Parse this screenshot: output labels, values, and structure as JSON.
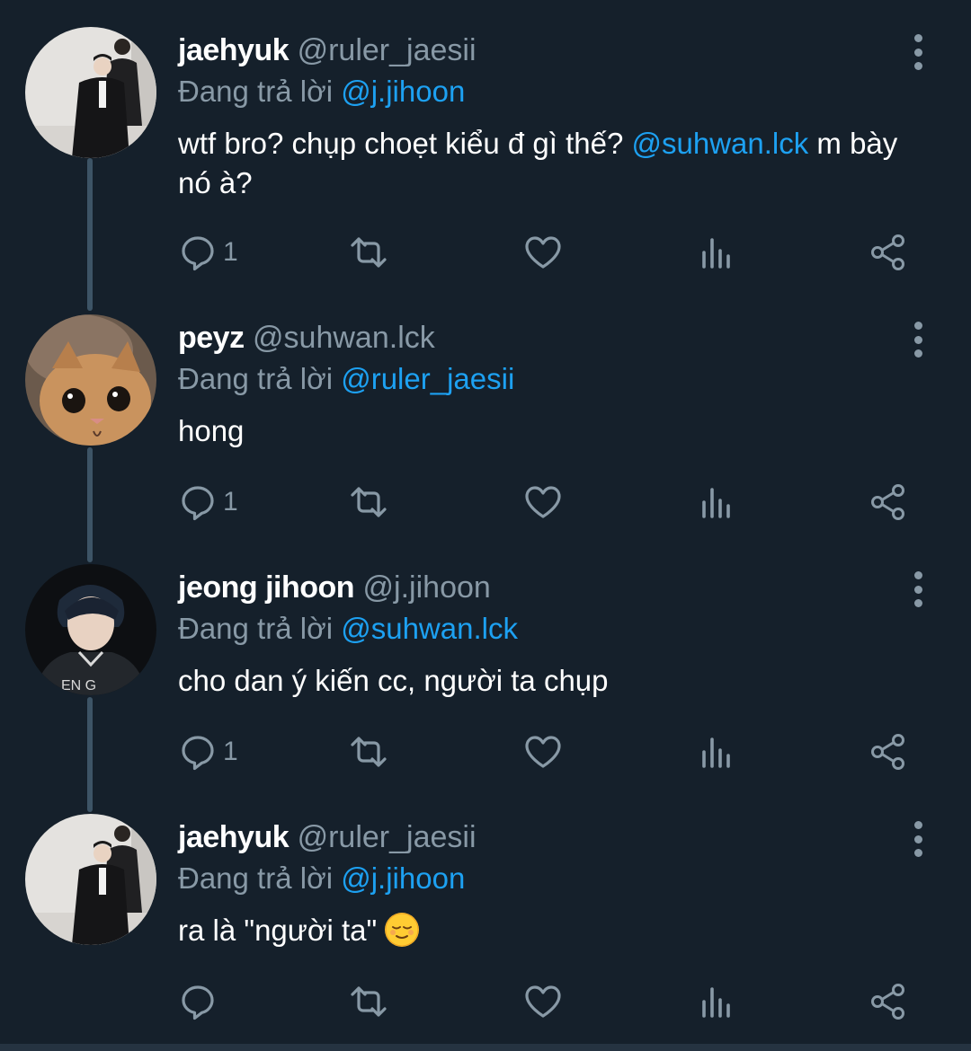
{
  "tweets": [
    {
      "name": "jaehyuk",
      "handle": "@ruler_jaesii",
      "reply_prefix": "Đang trả lời",
      "reply_to": "@j.jihoon",
      "text_before": "wtf bro? chụp choẹt kiểu đ gì thế?",
      "text_mention": "@suhwan.lck",
      "text_after": " m bày nó à?",
      "reply_count": "1",
      "avatar": "photo-two-men-in-black-coats"
    },
    {
      "name": "peyz",
      "handle": "@suhwan.lck",
      "reply_prefix": "Đang trả lời",
      "reply_to": "@ruler_jaesii",
      "text": "hong",
      "reply_count": "1",
      "avatar": "photo-cat-with-face-behind"
    },
    {
      "name": "jeong jihoon",
      "handle": "@j.jihoon",
      "reply_prefix": "Đang trả lời",
      "reply_to": "@suhwan.lck",
      "text": "cho dan ý kiến cc, người ta chụp",
      "reply_count": "1",
      "avatar": "photo-young-man-in-jersey"
    },
    {
      "name": "jaehyuk",
      "handle": "@ruler_jaesii",
      "reply_prefix": "Đang trả lời",
      "reply_to": "@j.jihoon",
      "text": "ra là \"người ta\"",
      "emoji": "relieved-face-emoji",
      "reply_count": "",
      "avatar": "photo-two-men-in-black-coats"
    }
  ],
  "icons": [
    "reply-icon",
    "retweet-icon",
    "like-icon",
    "analytics-icon",
    "share-icon",
    "more-options-icon"
  ],
  "colors": {
    "background": "#15202b",
    "text": "#ffffff",
    "secondary": "#8899a6",
    "accent": "#1da1f2",
    "thread_line": "#3d5466"
  }
}
